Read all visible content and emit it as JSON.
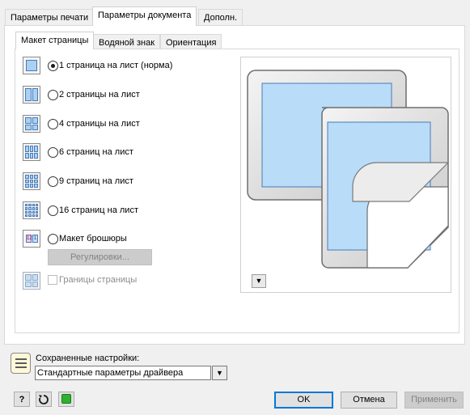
{
  "top_tabs": [
    "Параметры печати",
    "Параметры документа",
    "Дополн."
  ],
  "sub_tabs": [
    "Макет страницы",
    "Водяной знак",
    "Ориентация"
  ],
  "layout_options": [
    {
      "label": "1 страница на лист (норма)",
      "checked": true,
      "icon": "layout-1-up-icon"
    },
    {
      "label": "2 страницы на лист",
      "checked": false,
      "icon": "layout-2-up-icon"
    },
    {
      "label": "4 страницы на лист",
      "checked": false,
      "icon": "layout-4-up-icon"
    },
    {
      "label": "6 страниц на лист",
      "checked": false,
      "icon": "layout-6-up-icon"
    },
    {
      "label": "9 страниц на лист",
      "checked": false,
      "icon": "layout-9-up-icon"
    },
    {
      "label": "16 страниц на лист",
      "checked": false,
      "icon": "layout-16-up-icon"
    },
    {
      "label": "Макет брошюры",
      "checked": false,
      "icon": "booklet-icon"
    }
  ],
  "booklet_icon_text": "12 1",
  "adjust_button": "Регулировки...",
  "page_borders_label": "Границы страницы",
  "saved_settings": {
    "label": "Сохраненные настройки:",
    "value": "Стандартные параметры драйвера"
  },
  "buttons": {
    "ok": "OK",
    "cancel": "Отмена",
    "apply": "Применить"
  },
  "help_label": "?",
  "colors": {
    "accent": "#0078d7",
    "preview_fill": "#b9dcf9",
    "preview_border": "#4a7ab8"
  }
}
